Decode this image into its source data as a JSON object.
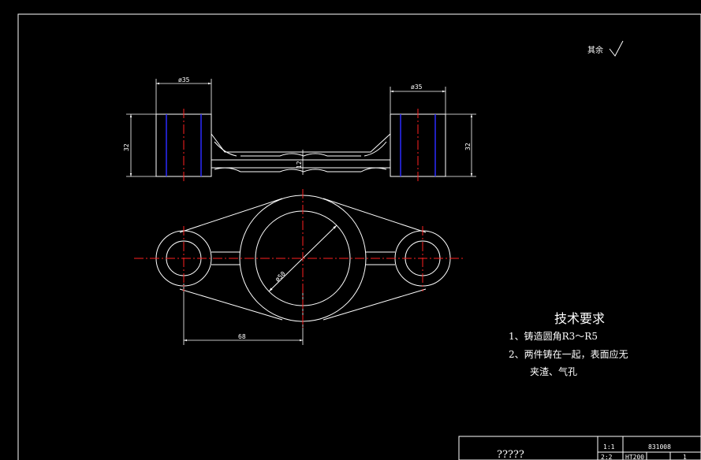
{
  "drawing": {
    "roughness_symbol": "其余",
    "dimensions": {
      "top_left_diameter": "ø35",
      "top_right_diameter": "ø35",
      "height_left": "32",
      "height_right": "32",
      "rib_thickness": "12",
      "bore_diameter": "ø50",
      "center_distance": "68"
    },
    "tech_requirements": {
      "title": "技术要求",
      "item1": "1、铸造圆角R3～R5",
      "item2": "2、两件铸在一起，表面应无",
      "item2_cont": "夹渣、气孔"
    },
    "title_block": {
      "part_name": "?????",
      "scale": "1:1",
      "drawing_number": "831008",
      "quantity": "2:2",
      "material": "HT200",
      "sheet": "1"
    },
    "colors": {
      "background": "#000000",
      "outline": "#ffffff",
      "centerline": "#ff2020",
      "hidden": "#2a2aff"
    }
  }
}
